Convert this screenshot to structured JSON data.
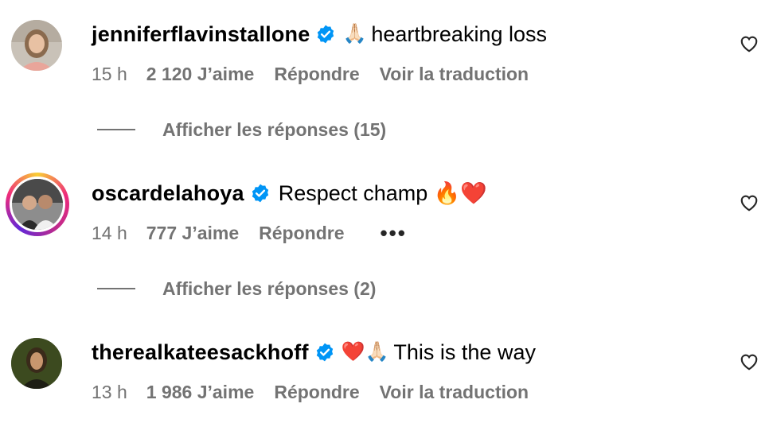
{
  "comments": [
    {
      "username": "jenniferflavinstallone",
      "emoji": "🙏🏻",
      "text": "heartbreaking loss",
      "time": "15 h",
      "likes": "2 120 J’aime",
      "reply_label": "Répondre",
      "translate_label": "Voir la traduction",
      "replies_label": "Afficher les réponses (15)",
      "avatar_icon": "profile-photo-woman"
    },
    {
      "username": "oscardelahoya",
      "emoji": "",
      "text": "Respect champ 🔥❤️",
      "time": "14 h",
      "likes": "777 J’aime",
      "reply_label": "Répondre",
      "more_label": "•••",
      "replies_label": "Afficher les réponses (2)",
      "avatar_icon": "profile-photo-two-men-story-ring"
    },
    {
      "username": "therealkateesackhoff",
      "emoji": "❤️🙏🏻",
      "text": "This is the way",
      "time": "13 h",
      "likes": "1 986 J’aime",
      "reply_label": "Répondre",
      "translate_label": "Voir la traduction",
      "avatar_icon": "profile-photo-dark-portrait"
    }
  ],
  "icons": {
    "verified": "verified-badge-icon",
    "like": "heart-outline-icon"
  },
  "colors": {
    "verified_blue": "#0095f6",
    "meta_gray": "#737373",
    "text": "#000000"
  }
}
